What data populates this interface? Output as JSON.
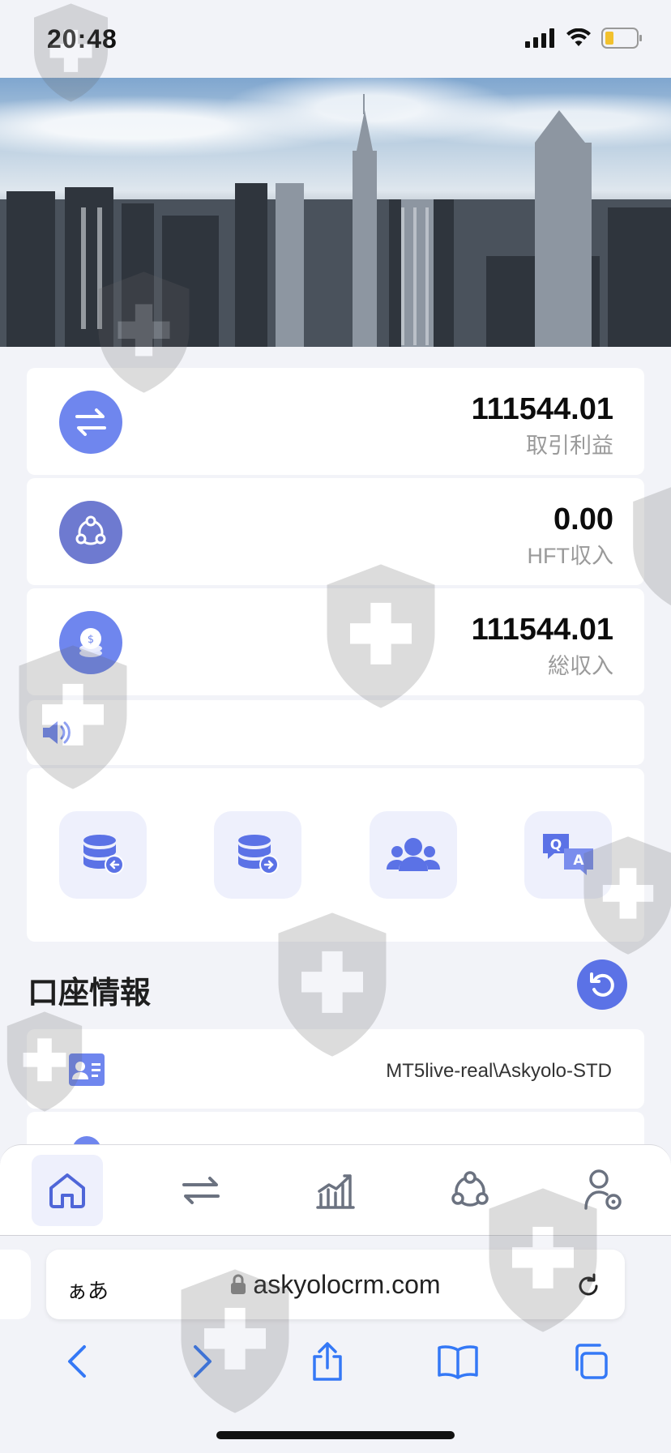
{
  "status_bar": {
    "time": "20:48"
  },
  "stats": [
    {
      "value": "111544.01",
      "label": "取引利益",
      "icon": "transfer-icon"
    },
    {
      "value": "0.00",
      "label": "HFT収入",
      "icon": "network-icon"
    },
    {
      "value": "111544.01",
      "label": "総収入",
      "icon": "coins-icon"
    }
  ],
  "notice": {
    "icon": "speaker-icon"
  },
  "quick_actions": [
    "deposit-icon",
    "withdraw-icon",
    "team-icon",
    "qa-icon"
  ],
  "account_section": {
    "title": "口座情報",
    "server": "MT5live-real\\Askyolo-STD"
  },
  "bottom_nav": [
    "home-icon",
    "transfer-icon",
    "chart-icon",
    "network-icon",
    "user-settings-icon"
  ],
  "browser": {
    "aa_label": "ぁあ",
    "url": "askyolocrm.com"
  },
  "colors": {
    "accent": "#5b72e6",
    "accent_light": "#eef0fc",
    "icon_gray": "#6b7280"
  }
}
